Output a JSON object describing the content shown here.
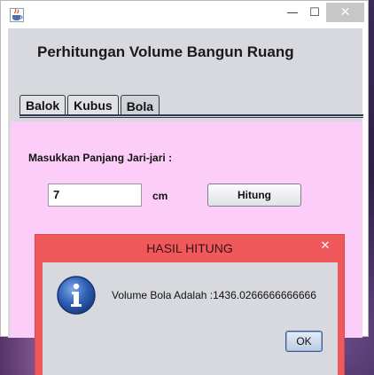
{
  "main_window": {
    "icon": "java-cup-icon",
    "controls": {
      "minimize_icon": "minimize-icon",
      "maximize_icon": "maximize-icon",
      "close_icon": "close-icon",
      "minimize": "—",
      "maximize": "☐",
      "close": "✕"
    },
    "heading": "Perhitungan Volume Bangun Ruang",
    "tabs": [
      {
        "label": "Balok",
        "active": false
      },
      {
        "label": "Kubus",
        "active": false
      },
      {
        "label": "Bola",
        "active": true
      }
    ],
    "panel": {
      "background": "#fccdf8",
      "prompt": "Masukkan Panjang Jari-jari :",
      "radius_value": "7",
      "unit": "cm",
      "button_label": "Hitung"
    }
  },
  "dialog": {
    "title": "HASIL HITUNG",
    "title_bar_color": "#f0595c",
    "close": "✕",
    "icon": "info-icon",
    "message": "Volume Bola Adalah :1436.0266666666666",
    "ok_label": "OK"
  }
}
